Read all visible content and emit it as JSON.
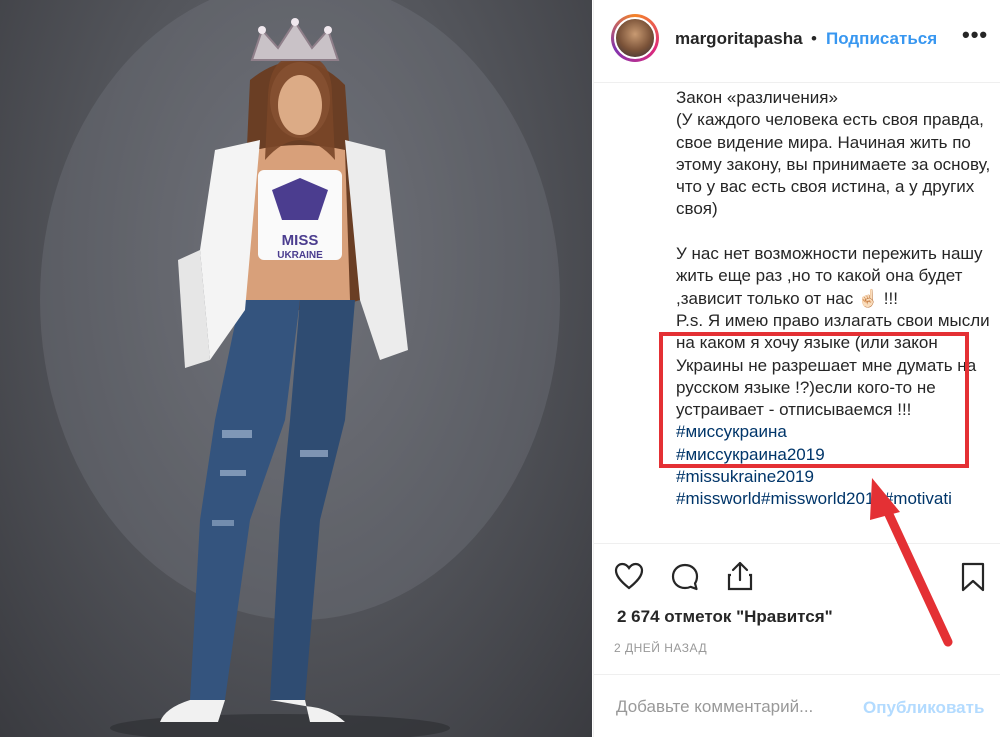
{
  "post": {
    "username": "margoritapasha",
    "separator": "•",
    "follow_label": "Подписаться",
    "more_label": "•••",
    "photo_alt": "Фото пользователя margoritapasha",
    "shirt_text_1": "MISS",
    "shirt_text_2": "UKRAINE"
  },
  "caption": {
    "intro": "Закон «различения»\n(У каждого человека есть своя правда, свое видение мира. Начиная жить по этому закону, вы принимаете за основу, что у вас есть своя истина, а у других своя)\n\nУ нас нет возможности пережить нашу жить еще раз ,но то какой она будет ,зависит только от нас ☝🏻 !!!\nP.s. Я имею право излагать свои мысли на каком я хочу языке (или закон Украины не разрешает мне думать на русском языке !?)если кого-то не устраивает - отписываемся !!! ",
    "tag_1": "#миссукраина",
    "tag_2": "#миссукраина2019",
    "tag_3": "#missukraine2019",
    "tag_4": "#missworld#missworld2019#motivati"
  },
  "stats": {
    "likes": "2 674 отметок \"Нравится\"",
    "time": "2 ДНЕЙ НАЗАД"
  },
  "comment": {
    "placeholder": "Добавьте комментарий...",
    "publish_label": "Опубликовать"
  },
  "icons": {
    "like": "heart-icon",
    "comment": "comment-icon",
    "share": "share-icon",
    "save": "bookmark-icon"
  },
  "colors": {
    "link": "#3897f0",
    "hashtag": "#003569",
    "highlight": "#e43034",
    "publish_disabled": "#b3dbff"
  }
}
